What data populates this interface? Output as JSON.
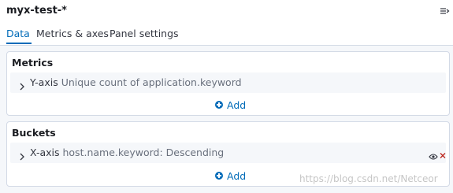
{
  "header": {
    "index_pattern": "myx-test-*",
    "collapse_icon": "menu-collapse-icon"
  },
  "tabs": [
    {
      "label": "Data",
      "active": true
    },
    {
      "label": "Metrics & axes",
      "active": false
    },
    {
      "label": "Panel settings",
      "active": false
    }
  ],
  "metrics": {
    "title": "Metrics",
    "aggs": [
      {
        "axis": "Y-axis",
        "description": "Unique count of application.keyword"
      }
    ],
    "add_label": "Add"
  },
  "buckets": {
    "title": "Buckets",
    "aggs": [
      {
        "axis": "X-axis",
        "description": "host.name.keyword: Descending",
        "icons": [
          "eye-icon",
          "remove-icon"
        ]
      }
    ],
    "add_label": "Add"
  },
  "colors": {
    "accent": "#006bb8",
    "danger": "#bd271e",
    "row_bg": "#f5f7fa"
  },
  "watermark": "https://blog.csdn.net/Netceor"
}
